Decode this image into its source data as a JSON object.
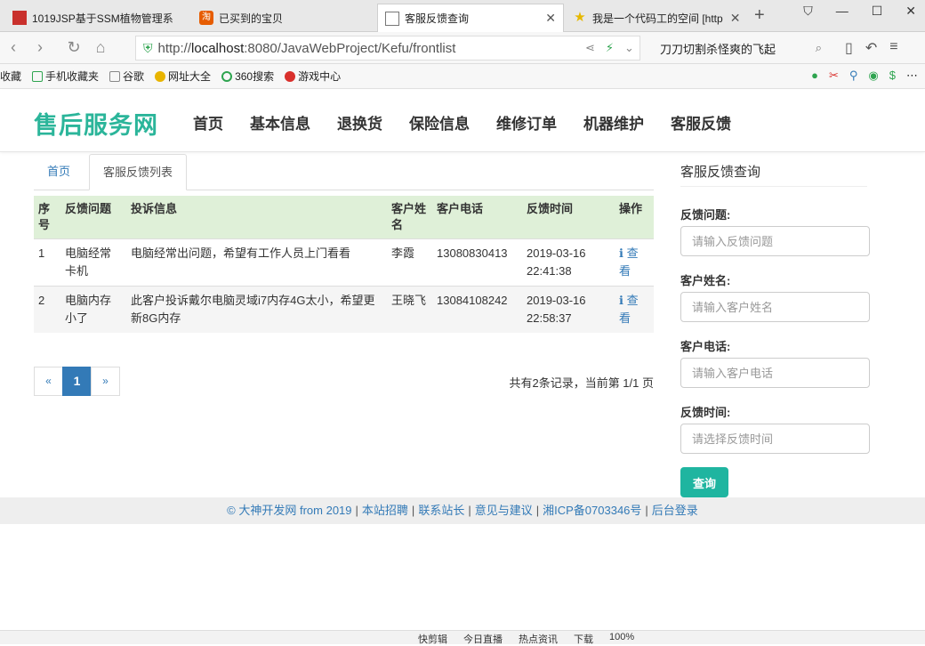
{
  "browser": {
    "tabs": [
      {
        "label": "1019JSP基于SSM植物管理系",
        "icon": "red-square-icon"
      },
      {
        "label": "已买到的宝贝",
        "icon": "taobao-icon"
      },
      {
        "label": "客服反馈查询",
        "icon": "document-icon",
        "active": true
      },
      {
        "label": "我是一个代码工的空间 [http",
        "icon": "star-icon"
      }
    ],
    "url_prefix": "http://",
    "url_host": "localhost",
    "url_path": ":8080/JavaWebProject/Kefu/frontlist",
    "search_text": "刀刀切割杀怪爽的飞起",
    "bookmarks": [
      "收藏",
      "手机收藏夹",
      "谷歌",
      "网址大全",
      "360搜索",
      "游戏中心"
    ]
  },
  "site": {
    "logo": "售后服务网",
    "nav": [
      "首页",
      "基本信息",
      "退换货",
      "保险信息",
      "维修订单",
      "机器维护",
      "客服反馈"
    ]
  },
  "content": {
    "tabs": [
      "首页",
      "客服反馈列表"
    ],
    "table": {
      "headers": [
        "序号",
        "反馈问题",
        "投诉信息",
        "客户姓名",
        "客户电话",
        "反馈时间",
        "操作"
      ],
      "rows": [
        {
          "no": "1",
          "question": "电脑经常卡机",
          "info": "电脑经常出问题，希望有工作人员上门看看",
          "name": "李霞",
          "phone": "13080830413",
          "time": "2019-03-16 22:41:38",
          "action": "查看"
        },
        {
          "no": "2",
          "question": "电脑内存小了",
          "info": "此客户投诉戴尔电脑灵域i7内存4G太小，希望更新8G内存",
          "name": "王晓飞",
          "phone": "13084108242",
          "time": "2019-03-16 22:58:37",
          "action": "查看"
        }
      ]
    },
    "pager": {
      "prev": "«",
      "current": "1",
      "next": "»"
    },
    "records": "共有2条记录，当前第 1/1 页"
  },
  "side": {
    "title": "客服反馈查询",
    "fields": [
      {
        "label": "反馈问题:",
        "placeholder": "请输入反馈问题"
      },
      {
        "label": "客户姓名:",
        "placeholder": "请输入客户姓名"
      },
      {
        "label": "客户电话:",
        "placeholder": "请输入客户电话"
      },
      {
        "label": "反馈时间:",
        "placeholder": "请选择反馈时间"
      }
    ],
    "button": "查询"
  },
  "footer": {
    "links": [
      "© 大神开发网 from 2019",
      "本站招聘",
      "联系站长",
      "意见与建议",
      "湘ICP备0703346号",
      "后台登录"
    ]
  },
  "statusbar": {
    "items": [
      "快剪辑",
      "今日直播",
      "热点资讯",
      "下载",
      "100%"
    ]
  },
  "colors": {
    "logo": "#2bb59a",
    "table_header_bg": "#dff0d8",
    "link": "#337ab7",
    "query_button": "#1fb5a0"
  }
}
